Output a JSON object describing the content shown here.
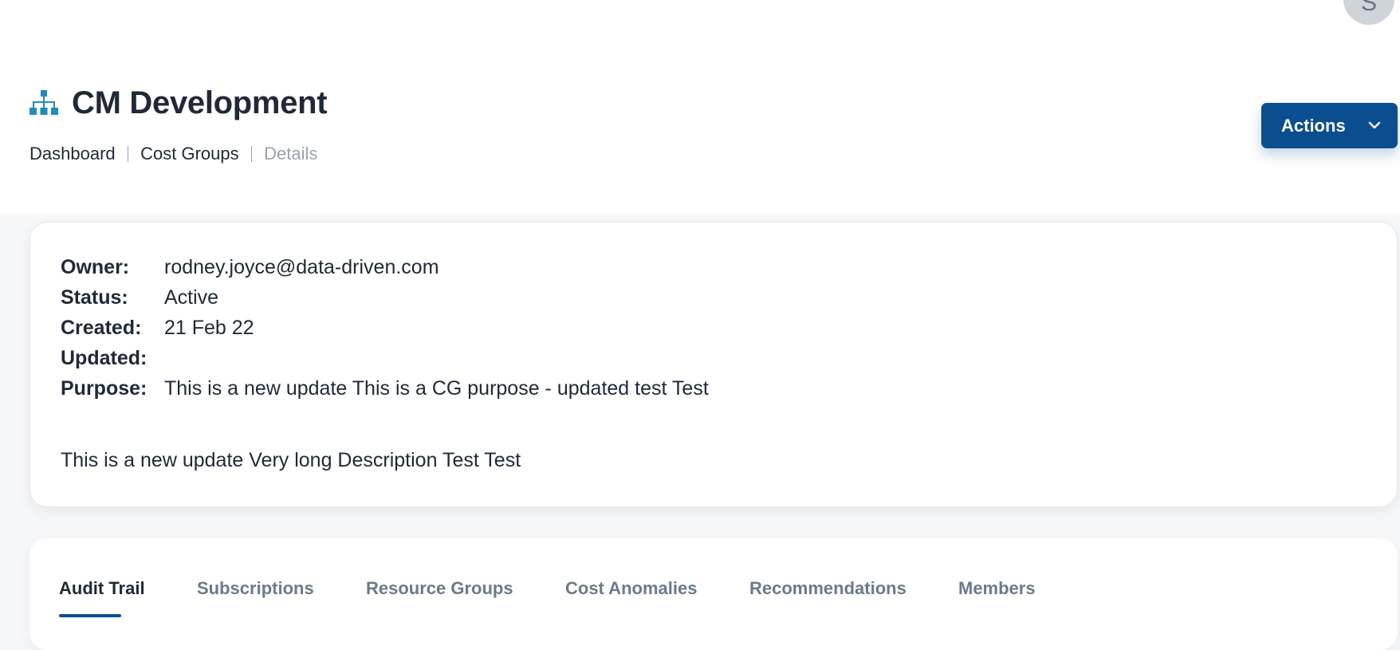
{
  "user": {
    "avatar_initial": "S"
  },
  "header": {
    "title": "CM Development",
    "icon": "sitemap-icon",
    "icon_color": "#1f8bbf"
  },
  "breadcrumb": [
    {
      "label": "Dashboard"
    },
    {
      "label": "Cost Groups"
    },
    {
      "label": "Details"
    }
  ],
  "actions": {
    "label": "Actions",
    "icon": "chevron-down-icon",
    "color": "#0b4e8f"
  },
  "details": {
    "owner": {
      "label": "Owner:",
      "value": "rodney.joyce@data-driven.com"
    },
    "status": {
      "label": "Status:",
      "value": "Active"
    },
    "created": {
      "label": "Created:",
      "value": "21 Feb 22"
    },
    "updated": {
      "label": "Updated:",
      "value": ""
    },
    "purpose": {
      "label": "Purpose:",
      "value": "This is a new update This is a CG purpose - updated test Test"
    },
    "description": "This is a new update Very long Description Test Test"
  },
  "tabs": [
    {
      "label": "Audit Trail",
      "active": true
    },
    {
      "label": "Subscriptions",
      "active": false
    },
    {
      "label": "Resource Groups",
      "active": false
    },
    {
      "label": "Cost Anomalies",
      "active": false
    },
    {
      "label": "Recommendations",
      "active": false
    },
    {
      "label": "Members",
      "active": false
    }
  ]
}
